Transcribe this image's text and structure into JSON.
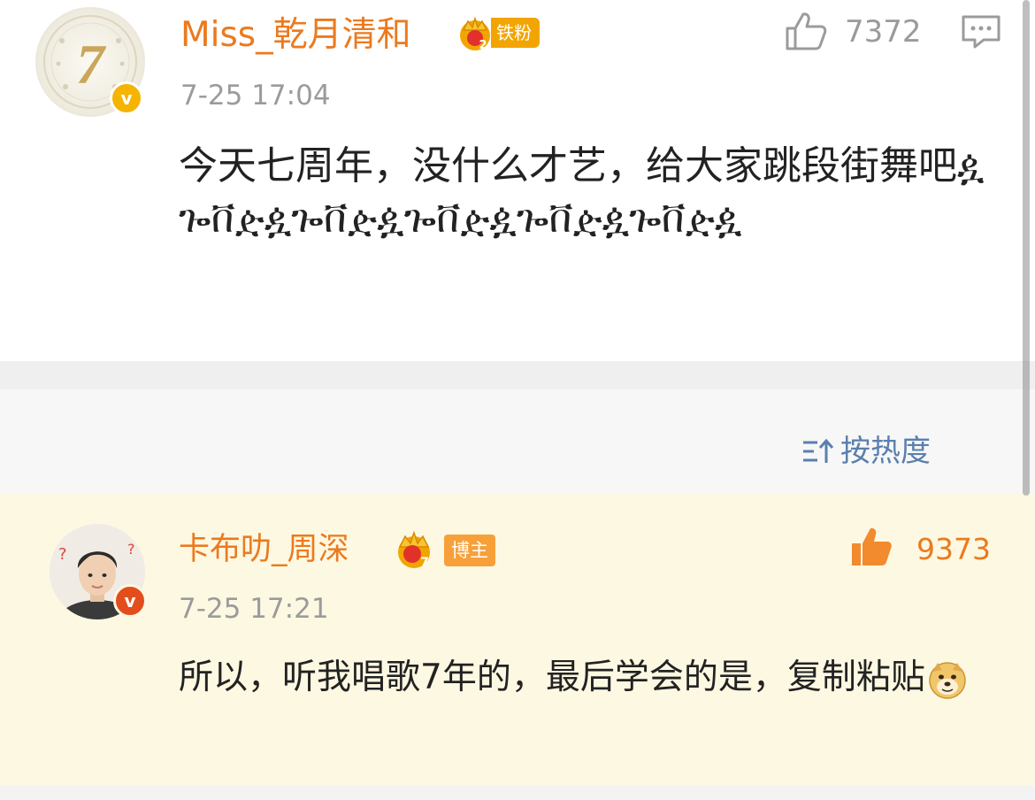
{
  "post": {
    "username": "Miss_乾月清和",
    "fan_badge": "铁粉",
    "crown_level": "2",
    "verified_mark": "v",
    "time": "7-25 17:04",
    "like_count": "7372",
    "text": "今天七周年，没什么才艺，给大家跳段街舞吧ዿጐ�android‍ዿጐቨዽዿጐቨዽዿጐቨዽዿጐቨዽዿጐቨዽዿ",
    "icons": {
      "like": "thumbs-up-icon",
      "comment": "comment-icon"
    }
  },
  "sort": {
    "label": "按热度",
    "icon": "sort-icon"
  },
  "comment": {
    "username": "卡布叻_周深",
    "role_badge": "博主",
    "crown_level": "7",
    "verified_mark": "v",
    "time": "7-25 17:21",
    "like_count": "9373",
    "text": "所以，听我唱歌7年的，最后学会的是，复制粘贴",
    "icons": {
      "like": "thumbs-up-filled-icon",
      "emoji": "doge-emoji-icon"
    }
  },
  "colors": {
    "username": "#eb7a1e",
    "meta": "#9b9b9b",
    "link_blue": "#5b7fad",
    "highlight_bg": "#fdf8e2",
    "badge_gold": "#f2a500",
    "badge_orange": "#f7a03a"
  }
}
